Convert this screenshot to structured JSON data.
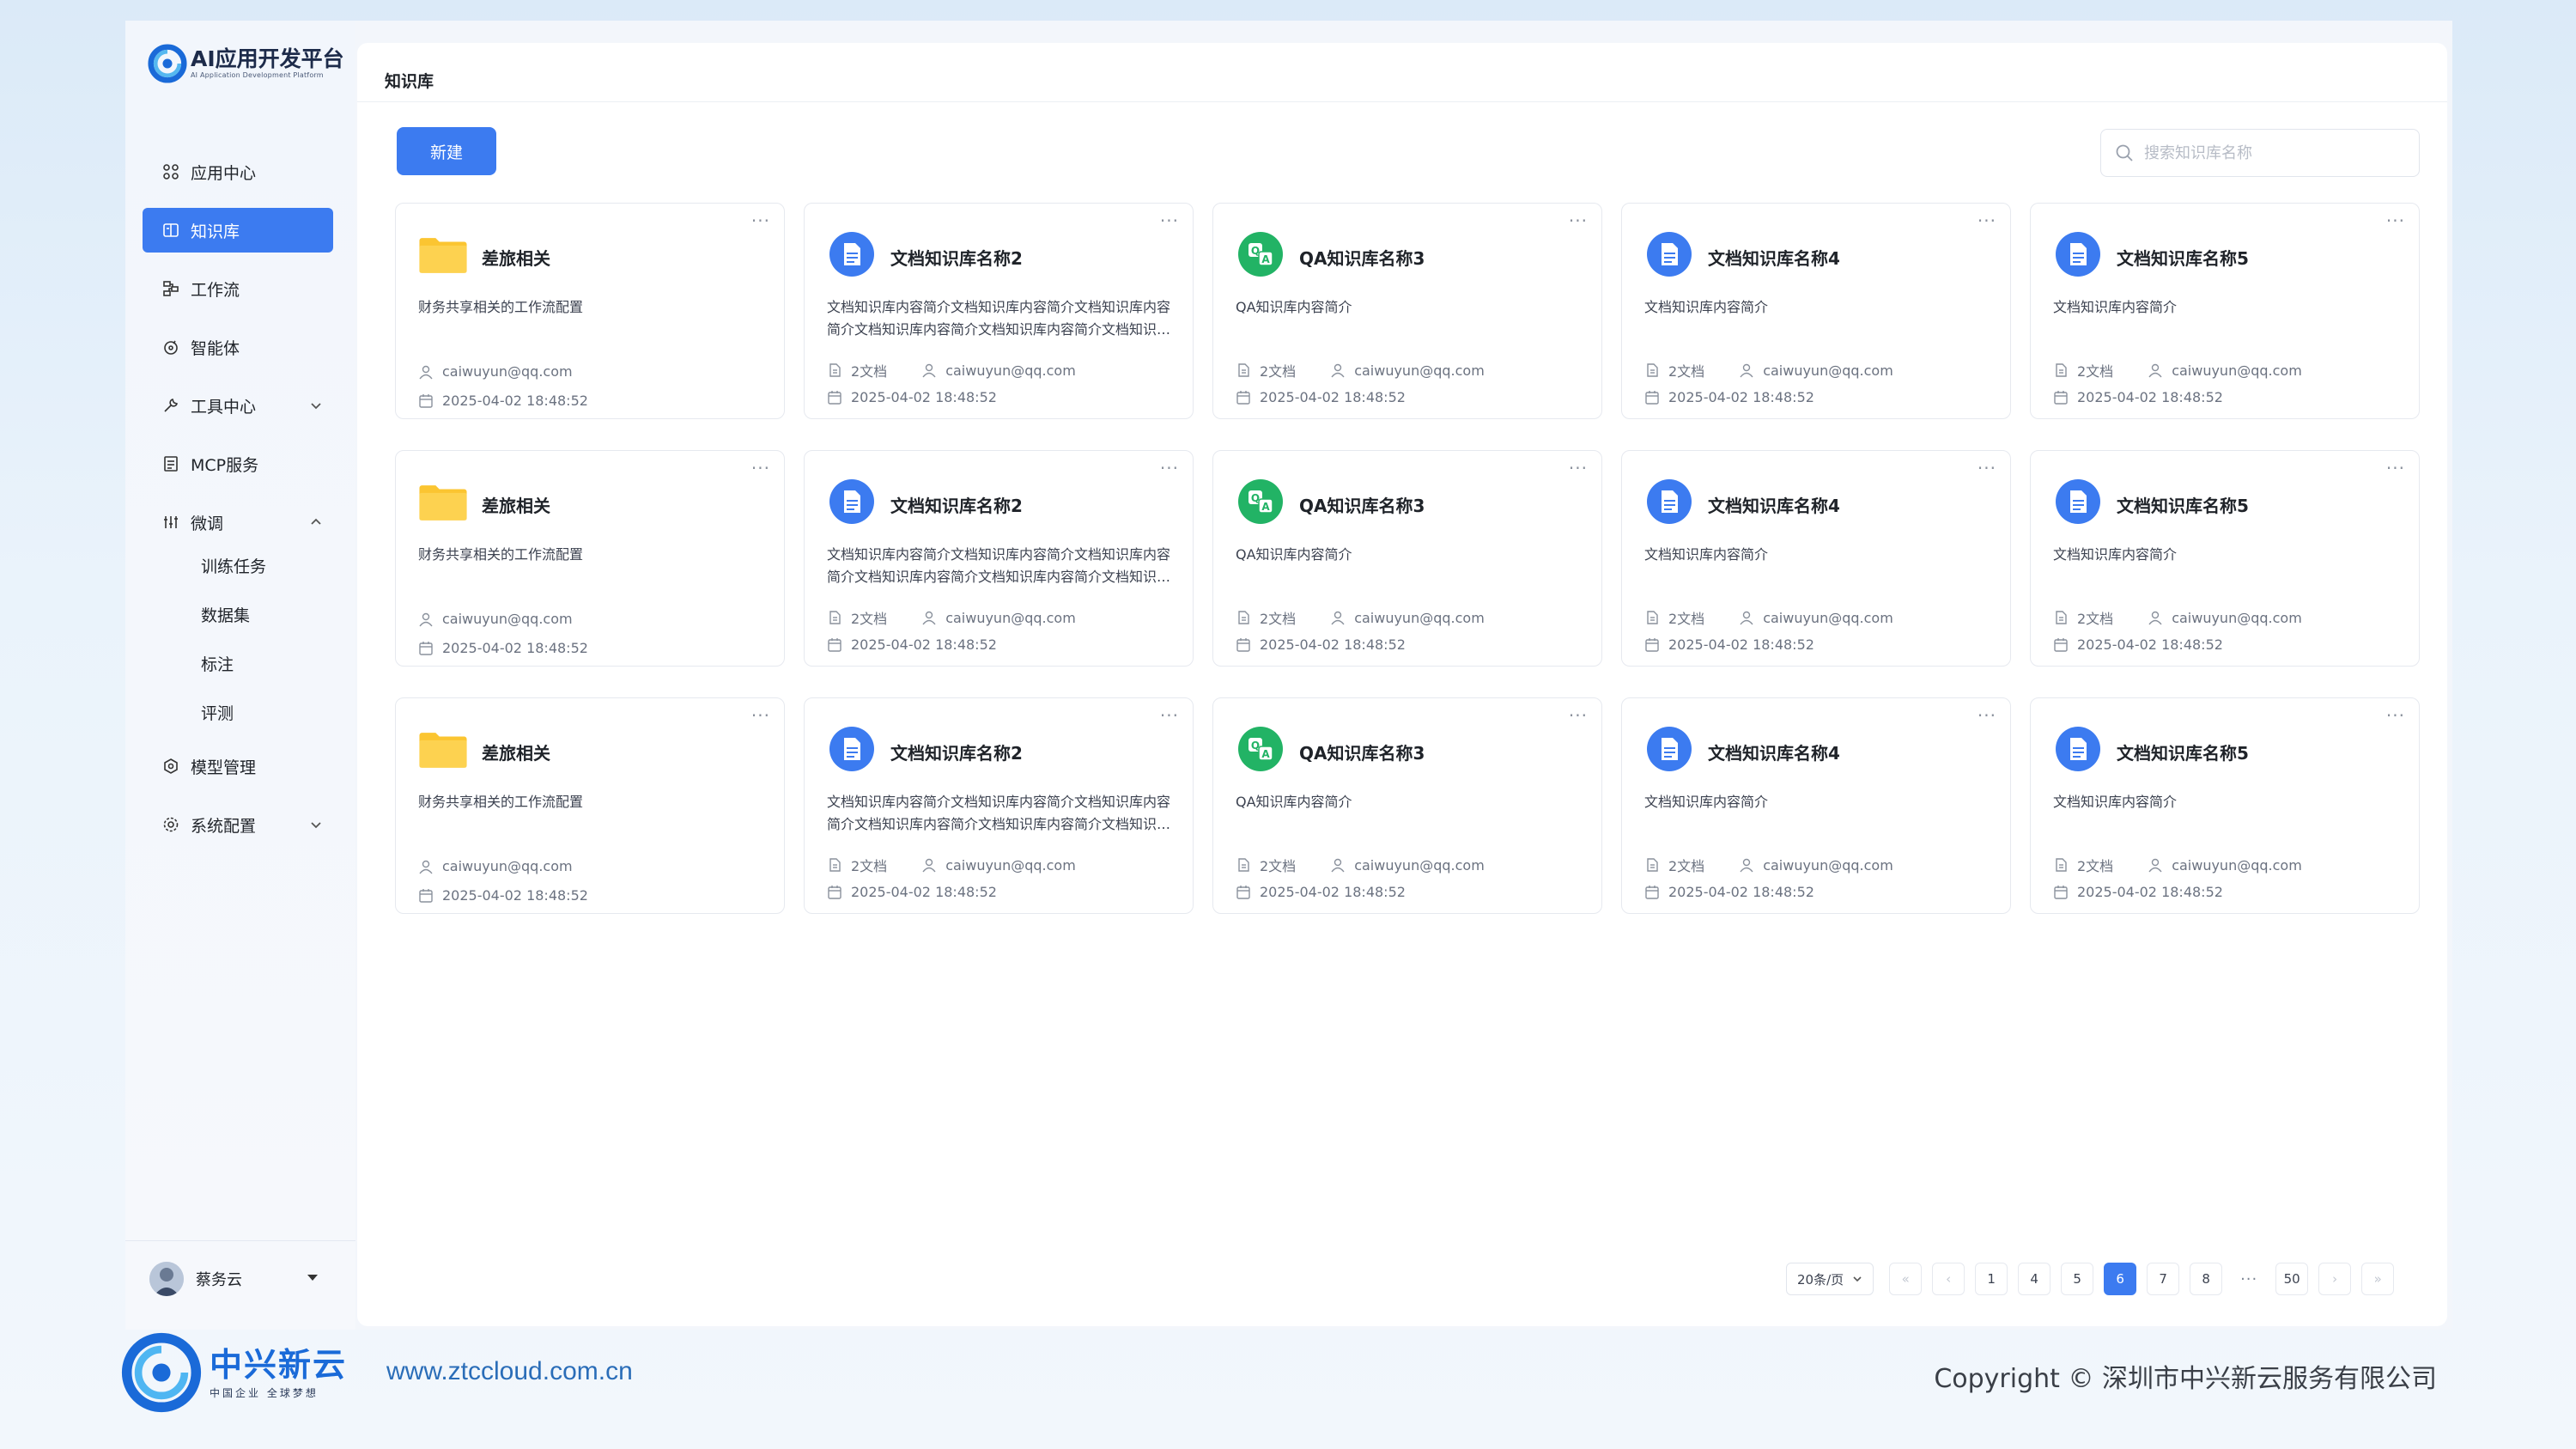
{
  "app": {
    "logo_title": "AI应用开发平台",
    "logo_subtitle": "AI Application Development Platform"
  },
  "sidebar": {
    "items": [
      {
        "label": "应用中心",
        "icon": "apps-icon"
      },
      {
        "label": "知识库",
        "icon": "knowledge-icon",
        "active": true
      },
      {
        "label": "工作流",
        "icon": "workflow-icon"
      },
      {
        "label": "智能体",
        "icon": "agent-icon"
      },
      {
        "label": "工具中心",
        "icon": "tool-icon",
        "chevron": "down"
      },
      {
        "label": "MCP服务",
        "icon": "mcp-icon"
      },
      {
        "label": "微调",
        "icon": "finetune-icon",
        "chevron": "up"
      }
    ],
    "sub_items": [
      "训练任务",
      "数据集",
      "标注",
      "评测"
    ],
    "items_after": [
      {
        "label": "模型管理",
        "icon": "model-icon"
      },
      {
        "label": "系统配置",
        "icon": "settings-icon",
        "chevron": "down"
      }
    ],
    "user_name": "蔡务云"
  },
  "main": {
    "title": "知识库",
    "new_button": "新建",
    "search_placeholder": "搜索知识库名称"
  },
  "cards": {
    "folder": {
      "title": "差旅相关",
      "desc": "财务共享相关的工作流配置",
      "email": "caiwuyun@qq.com",
      "date": "2025-04-02 18:48:52"
    },
    "doc2": {
      "title": "文档知识库名称2",
      "desc": "文档知识库内容简介文档知识库内容简介文档知识库内容简介文档知识库内容简介文档知识库内容简介文档知识库内容简介",
      "docs": "2文档",
      "email": "caiwuyun@qq.com",
      "date": "2025-04-02 18:48:52"
    },
    "qa3": {
      "title": "QA知识库名称3",
      "desc": "QA知识库内容简介",
      "docs": "2文档",
      "email": "caiwuyun@qq.com",
      "date": "2025-04-02 18:48:52"
    },
    "doc4": {
      "title": "文档知识库名称4",
      "desc": "文档知识库内容简介",
      "docs": "2文档",
      "email": "caiwuyun@qq.com",
      "date": "2025-04-02 18:48:52"
    },
    "doc5": {
      "title": "文档知识库名称5",
      "desc": "文档知识库内容简介",
      "docs": "2文档",
      "email": "caiwuyun@qq.com",
      "date": "2025-04-02 18:48:52"
    },
    "more": "···"
  },
  "pagination": {
    "page_size": "20条/页",
    "pages": [
      "1",
      "4",
      "5",
      "6",
      "7",
      "8",
      "50"
    ],
    "current": "6",
    "ellipsis": "···",
    "first": "«",
    "prev": "‹",
    "next": "›",
    "last": "»"
  },
  "footer": {
    "brand": "中兴新云",
    "slogan": "中国企业 全球梦想",
    "url": "www.ztccloud.com.cn",
    "copyright": "Copyright © 深圳市中兴新云服务有限公司"
  },
  "colors": {
    "accent": "#3c7bf0",
    "folder": "#fbc531",
    "doc_icon": "#3c7bf0",
    "qa_icon": "#22b365"
  }
}
